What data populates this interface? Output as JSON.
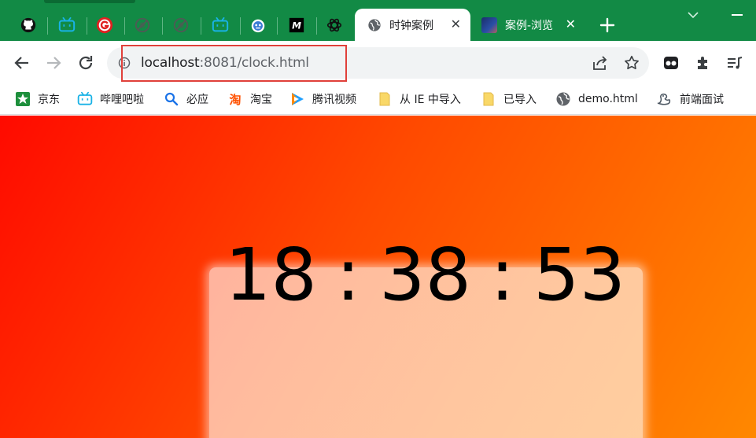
{
  "tabs": {
    "pinned_icons": [
      "github-icon",
      "bilibili-icon",
      "g-logo-icon",
      "blocked-site-icon",
      "blocked-site-icon",
      "bilibili-icon",
      "bot-face-icon",
      "m-logo-icon",
      "openai-icon"
    ],
    "active": {
      "title": "时钟案例",
      "icon": "globe-icon"
    },
    "next": {
      "title": "案例-浏览",
      "icon": "avatar-icon"
    }
  },
  "address": {
    "host": "localhost",
    "rest": ":8081/clock.html"
  },
  "bookmarks": [
    {
      "label": "京东",
      "icon": "jd-icon"
    },
    {
      "label": "哔哩吧啦",
      "icon": "bilibili-icon"
    },
    {
      "label": "必应",
      "icon": "search-icon"
    },
    {
      "label": "淘宝",
      "icon": "taobao-icon"
    },
    {
      "label": "腾讯视频",
      "icon": "tencent-video-icon"
    },
    {
      "label": "从 IE 中导入",
      "icon": "folder-icon"
    },
    {
      "label": "已导入",
      "icon": "folder-icon"
    },
    {
      "label": "demo.html",
      "icon": "globe-icon"
    },
    {
      "label": "前端面试",
      "icon": "dragon-icon"
    }
  ],
  "clock": {
    "hours": "18",
    "minutes": "38",
    "seconds": "53",
    "separator": ":"
  },
  "colors": {
    "tabstrip": "#128a45",
    "highlight_box": "#e0403a",
    "page_gradient_start": "#ff0a00",
    "page_gradient_end": "#ff8800"
  }
}
